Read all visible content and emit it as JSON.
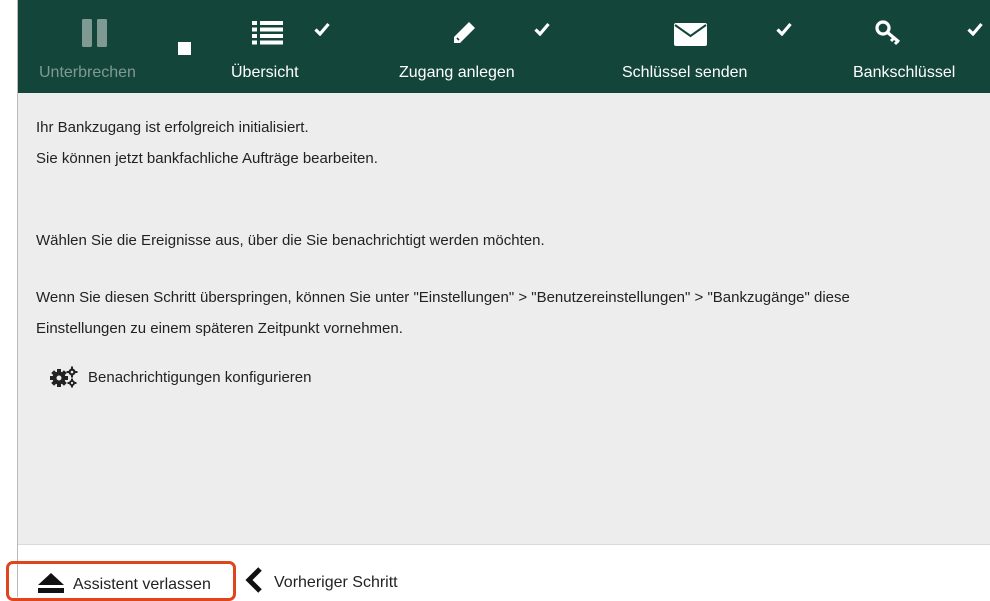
{
  "colors": {
    "toolbar_bg": "#14453a",
    "toolbar_text": "#ffffff",
    "toolbar_text_disabled": "#7f9a92",
    "content_bg": "#ededed",
    "highlight_border": "#e0451c"
  },
  "toolbar": {
    "pause": {
      "label": "Unterbrechen",
      "icon": "pause-icon",
      "disabled": true
    },
    "stop": {
      "icon": "stop-icon"
    },
    "steps": [
      {
        "label": "Übersicht",
        "icon": "list-icon",
        "completed": true
      },
      {
        "label": "Zugang anlegen",
        "icon": "pencil-icon",
        "completed": true
      },
      {
        "label": "Schlüssel senden",
        "icon": "envelope-icon",
        "completed": true
      },
      {
        "label": "Bankschlüssel",
        "icon": "key-icon",
        "completed": true
      }
    ]
  },
  "content": {
    "line1": "Ihr Bankzugang ist erfolgreich initialisiert.",
    "line2": "Sie können jetzt bankfachliche Aufträge bearbeiten.",
    "line3": "Wählen Sie die Ereignisse aus, über die Sie benachrichtigt werden möchten.",
    "line4": "Wenn Sie diesen Schritt überspringen, können Sie unter \"Einstellungen\" > \"Benutzereinstellungen\" > \"Bankzugänge\" diese",
    "line5": "Einstellungen zu einem späteren Zeitpunkt vornehmen.",
    "configure_link": "Benachrichtigungen konfigurieren"
  },
  "footer": {
    "exit_label": "Assistent verlassen",
    "back_label": "Vorheriger Schritt"
  }
}
